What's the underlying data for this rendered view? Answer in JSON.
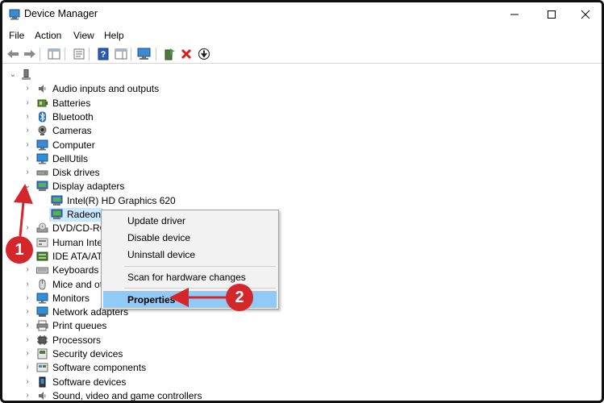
{
  "window": {
    "title": "Device Manager"
  },
  "menu": [
    "File",
    "Action",
    "View",
    "Help"
  ],
  "tree": {
    "root_expanded": true,
    "categories": [
      {
        "label": "Audio inputs and outputs",
        "icon": "speaker-icon"
      },
      {
        "label": "Batteries",
        "icon": "battery-icon"
      },
      {
        "label": "Bluetooth",
        "icon": "bluetooth-icon"
      },
      {
        "label": "Cameras",
        "icon": "camera-icon"
      },
      {
        "label": "Computer",
        "icon": "computer-icon"
      },
      {
        "label": "DellUtils",
        "icon": "monitor-icon"
      },
      {
        "label": "Disk drives",
        "icon": "disk-drive-icon"
      },
      {
        "label": "Display adapters",
        "icon": "display-adapter-icon",
        "expanded": true,
        "children": [
          {
            "label": "Intel(R) HD Graphics 620",
            "icon": "display-adapter-icon"
          },
          {
            "label": "Radeon",
            "icon": "display-adapter-icon",
            "selected": true
          }
        ]
      },
      {
        "label": "DVD/CD-RO",
        "icon": "dvd-icon"
      },
      {
        "label": "Human Inte",
        "icon": "hid-icon"
      },
      {
        "label": "IDE ATA/ATAI",
        "icon": "ide-icon"
      },
      {
        "label": "Keyboards",
        "icon": "keyboard-icon"
      },
      {
        "label": "Mice and ot",
        "icon": "mouse-icon"
      },
      {
        "label": "Monitors",
        "icon": "monitor-icon"
      },
      {
        "label": "Network adapters",
        "icon": "network-icon"
      },
      {
        "label": "Print queues",
        "icon": "printer-icon"
      },
      {
        "label": "Processors",
        "icon": "processor-icon"
      },
      {
        "label": "Security devices",
        "icon": "security-icon"
      },
      {
        "label": "Software components",
        "icon": "software-icon"
      },
      {
        "label": "Software devices",
        "icon": "software-device-icon"
      },
      {
        "label": "Sound, video and game controllers",
        "icon": "speaker-icon"
      }
    ]
  },
  "context_menu": {
    "items": [
      "Update driver",
      "Disable device",
      "Uninstall device",
      "Scan for hardware changes",
      "Properties"
    ],
    "highlighted": "Properties"
  },
  "annotations": {
    "step1": "1",
    "step2": "2",
    "color": "#d4262b"
  },
  "colors": {
    "selection": "#cce8ff",
    "menu_highlight": "#91c9f7"
  }
}
